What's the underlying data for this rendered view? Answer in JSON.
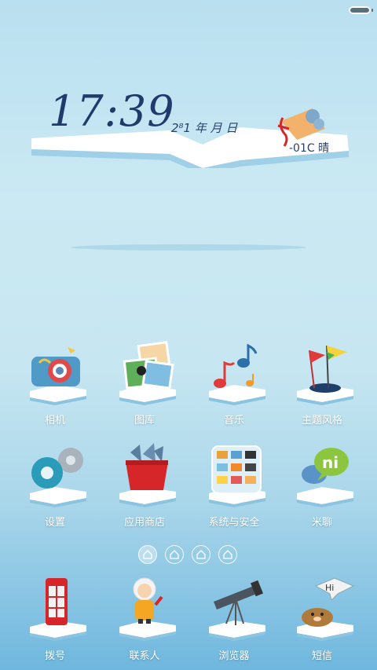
{
  "status_bar": {
    "battery": "battery-icon"
  },
  "clock": {
    "time": "17:39",
    "date": "2⁸1 年 月 日",
    "weather": "-01C 晴"
  },
  "apps_row1": [
    {
      "label": "相机",
      "icon": "camera-icon"
    },
    {
      "label": "图库",
      "icon": "gallery-icon"
    },
    {
      "label": "音乐",
      "icon": "music-icon"
    },
    {
      "label": "主题风格",
      "icon": "theme-flags-icon"
    }
  ],
  "apps_row2": [
    {
      "label": "设置",
      "icon": "gears-icon"
    },
    {
      "label": "应用商店",
      "icon": "fish-bucket-icon"
    },
    {
      "label": "系统与安全",
      "icon": "system-folder-icon"
    },
    {
      "label": "米聊",
      "icon": "chat-bubble-icon"
    }
  ],
  "page_indicator": {
    "pages": 4,
    "active_index": 0
  },
  "dock": [
    {
      "label": "拨号",
      "icon": "phone-booth-icon"
    },
    {
      "label": "联系人",
      "icon": "eskimo-icon"
    },
    {
      "label": "浏览器",
      "icon": "telescope-icon"
    },
    {
      "label": "短信",
      "icon": "seal-hi-icon"
    }
  ],
  "colors": {
    "sky_top": "#b9e0f0",
    "sea_bottom": "#6fb7de",
    "label_text": "#ffffff",
    "clock_text": "#1f3a6b"
  }
}
